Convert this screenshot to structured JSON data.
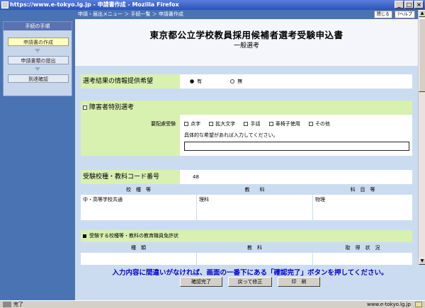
{
  "window": {
    "title": "https://www.e-tokyo.lg.jp - 申請書作成 - Mozilla Firefox"
  },
  "sidebar": {
    "title": "手続の手順",
    "steps": [
      "申請書の作成",
      "申請書類の提出",
      "到達確認"
    ]
  },
  "breadcrumb": {
    "text": "申請・届出メニュー ＞ 手続一覧 ＞ 申請書作成",
    "close_label": "閉じる",
    "help_label": "?ヘルプ"
  },
  "form": {
    "title": "東京都公立学校教員採用候補者選考受験申込書",
    "subtitle": "一般選考",
    "info_provision": {
      "label": "選考結果の情報提供希望",
      "options": [
        "有",
        "無"
      ]
    },
    "disability": {
      "label": "障害者特別選考",
      "consideration_label": "要配慮受験",
      "options": [
        "点字",
        "拡大文字",
        "手話",
        "車椅子使用",
        "その他"
      ],
      "instruction": "具体的な希望があれば入力してください。",
      "input_value": ""
    },
    "exam_code": {
      "label": "受験校種・教科コード番号",
      "value": "48",
      "columns": [
        "校　種　等",
        "教　　科",
        "科　目　等"
      ],
      "row": [
        "中・高等学校共通",
        "理科",
        "物理"
      ]
    },
    "license": {
      "label": "受験する校種等・教科の教育職員免許状",
      "columns": [
        "種　類",
        "教　科",
        "取　得　状　況"
      ]
    }
  },
  "footer": {
    "notice": "入力内容に間違いがなければ、画面の一番下にある「確認完了」ボタンを押してください。",
    "buttons": [
      "確認完了",
      "戻って修正",
      "印　刷"
    ]
  },
  "statusbar": {
    "left": "完了",
    "right": "www.e-tokyo.lg.jp"
  }
}
